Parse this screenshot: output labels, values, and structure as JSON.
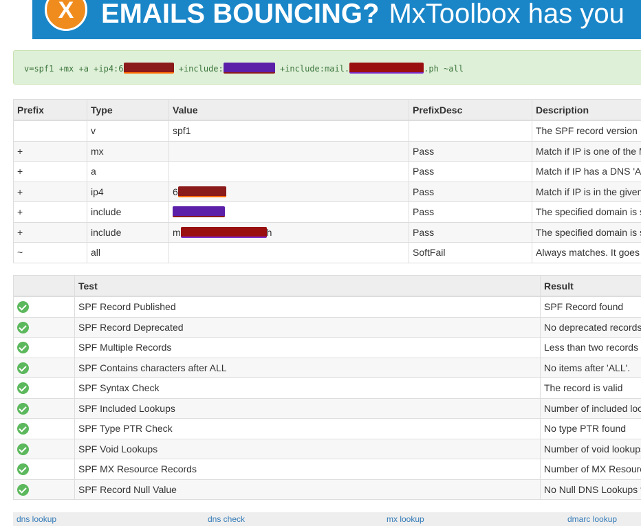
{
  "banner": {
    "logo_letter": "X",
    "headline_bold": "EMAILS BOUNCING?",
    "headline_rest": "MxToolbox has you"
  },
  "spf_record": {
    "part1": "v=spf1 +mx +a +ip4:6",
    "part2": " +include:",
    "part3": " +include:mail.",
    "part4": ".ph ~all"
  },
  "mechanisms": {
    "headers": [
      "Prefix",
      "Type",
      "Value",
      "PrefixDesc",
      "Description"
    ],
    "rows": [
      {
        "prefix": "",
        "type": "v",
        "value": "spf1",
        "desc": "",
        "description": "The SPF record version"
      },
      {
        "prefix": "+",
        "type": "mx",
        "value": "",
        "desc": "Pass",
        "description": "Match if IP is one of the MX"
      },
      {
        "prefix": "+",
        "type": "a",
        "value": "",
        "desc": "Pass",
        "description": "Match if IP has a DNS 'A' r"
      },
      {
        "prefix": "+",
        "type": "ip4",
        "value": "6",
        "desc": "Pass",
        "description": "Match if IP is in the given r"
      },
      {
        "prefix": "+",
        "type": "include",
        "value": "",
        "desc": "Pass",
        "description": "The specified domain is se"
      },
      {
        "prefix": "+",
        "type": "include",
        "value": "m",
        "value_suffix": "h",
        "desc": "Pass",
        "description": "The specified domain is se"
      },
      {
        "prefix": "~",
        "type": "all",
        "value": "",
        "desc": "SoftFail",
        "description": "Always matches. It goes at"
      }
    ]
  },
  "tests": {
    "headers": [
      "",
      "Test",
      "Result"
    ],
    "rows": [
      {
        "test": "SPF Record Published",
        "result": "SPF Record found"
      },
      {
        "test": "SPF Record Deprecated",
        "result": "No deprecated records fo"
      },
      {
        "test": "SPF Multiple Records",
        "result": "Less than two records fo"
      },
      {
        "test": "SPF Contains characters after ALL",
        "result": "No items after 'ALL'."
      },
      {
        "test": "SPF Syntax Check",
        "result": "The record is valid"
      },
      {
        "test": "SPF Included Lookups",
        "result": "Number of included looku"
      },
      {
        "test": "SPF Type PTR Check",
        "result": "No type PTR found"
      },
      {
        "test": "SPF Void Lookups",
        "result": "Number of void lookups i"
      },
      {
        "test": "SPF MX Resource Records",
        "result": "Number of MX Resource"
      },
      {
        "test": "SPF Record Null Value",
        "result": "No Null DNS Lookups fo"
      }
    ]
  },
  "footer_links": [
    "dns lookup",
    "dns check",
    "mx lookup",
    "dmarc lookup"
  ],
  "colors": {
    "pass_icon": "#5cb85c",
    "record_box": "#dff0d8",
    "banner": "#1a86c8",
    "link": "#337ab7"
  }
}
